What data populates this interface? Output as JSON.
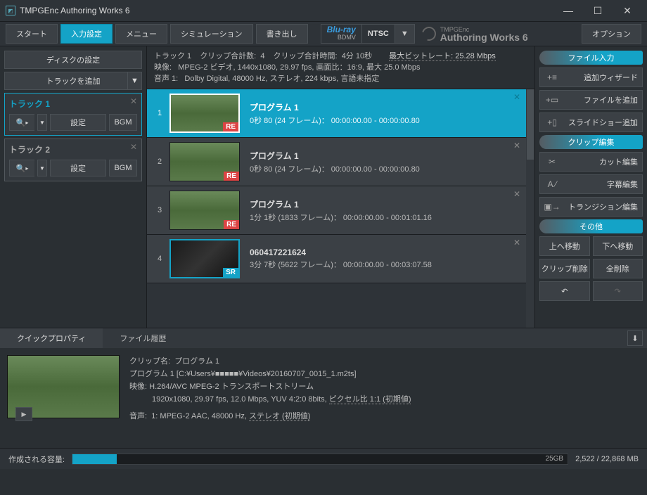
{
  "titlebar": {
    "title": "TMPGEnc Authoring Works 6"
  },
  "toolbar": {
    "start": "スタート",
    "input": "入力設定",
    "menu": "メニュー",
    "simulation": "シミュレーション",
    "export": "書き出し",
    "bluray": "Blu-ray",
    "bdmv": "BDMV",
    "ntsc": "NTSC",
    "brand_small": "TMPGEnc",
    "brand_large": "Authoring Works 6",
    "option": "オプション"
  },
  "left": {
    "disc_settings": "ディスクの設定",
    "add_track": "トラックを追加",
    "tracks": [
      {
        "name": "トラック 1",
        "settings": "設定",
        "bgm": "BGM"
      },
      {
        "name": "トラック 2",
        "settings": "設定",
        "bgm": "BGM"
      }
    ]
  },
  "info": {
    "track_label": "トラック 1",
    "clip_count_label": "クリップ合計数:",
    "clip_count": "4",
    "duration_label": "クリップ合計時間:",
    "duration": "4分 10秒",
    "bitrate_label": "最大ビットレート: 25.28 Mbps",
    "video_label": "映像:",
    "video_info": "MPEG-2 ビデオ,  1440x1080,  29.97 fps,  画面比：16:9,  最大 25.0 Mbps",
    "audio_label": "音声 1:",
    "audio_info": "Dolby Digital,  48000 Hz,  ステレオ,  224 kbps,  言語未指定"
  },
  "clips": [
    {
      "num": "1",
      "title": "プログラム 1",
      "meta": "0秒 80 (24 フレーム)： 00:00:00.00 - 00:00:00.80",
      "badge": "RE"
    },
    {
      "num": "2",
      "title": "プログラム 1",
      "meta": "0秒 80 (24 フレーム)： 00:00:00.00 - 00:00:00.80",
      "badge": "RE"
    },
    {
      "num": "3",
      "title": "プログラム 1",
      "meta": "1分 1秒 (1833 フレーム)： 00:00:00.00 - 00:01:01.16",
      "badge": "RE"
    },
    {
      "num": "4",
      "title": "060417221624",
      "meta": "3分 7秒 (5622 フレーム)： 00:00:00.00 - 00:03:07.58",
      "badge": "SR"
    }
  ],
  "right": {
    "file_input": "ファイル入力",
    "add_wizard": "追加ウィザード",
    "add_file": "ファイルを追加",
    "add_slideshow": "スライドショー追加",
    "clip_edit": "クリップ編集",
    "cut_edit": "カット編集",
    "subtitle_edit": "字幕編集",
    "transition_edit": "トランジション編集",
    "other": "その他",
    "move_up": "上へ移動",
    "move_down": "下へ移動",
    "clip_delete": "クリップ削除",
    "delete_all": "全削除"
  },
  "tabs": {
    "quick_prop": "クイックプロパティ",
    "file_history": "ファイル履歴"
  },
  "prop": {
    "clip_name_label": "クリップ名:",
    "clip_name": "プログラム 1",
    "path": "プログラム 1 [C:¥Users¥■■■■■¥Videos¥20160707_0015_1.m2ts]",
    "video_label": "映像:",
    "video1": "H.264/AVC  MPEG-2 トランスポートストリーム",
    "video2a": "1920x1080,  29.97 fps,  12.0 Mbps,  YUV 4:2:0 8bits,",
    "video2b": "ピクセル比 1:1 (初期値)",
    "audio_label": "音声:",
    "audio1a": "1:  MPEG-2 AAC, 48000 Hz,",
    "audio1b": "ステレオ (初期値)"
  },
  "status": {
    "capacity_label": "作成される容量:",
    "cap_marker": "25GB",
    "capacity_text": "2,522 / 22,868 MB"
  }
}
